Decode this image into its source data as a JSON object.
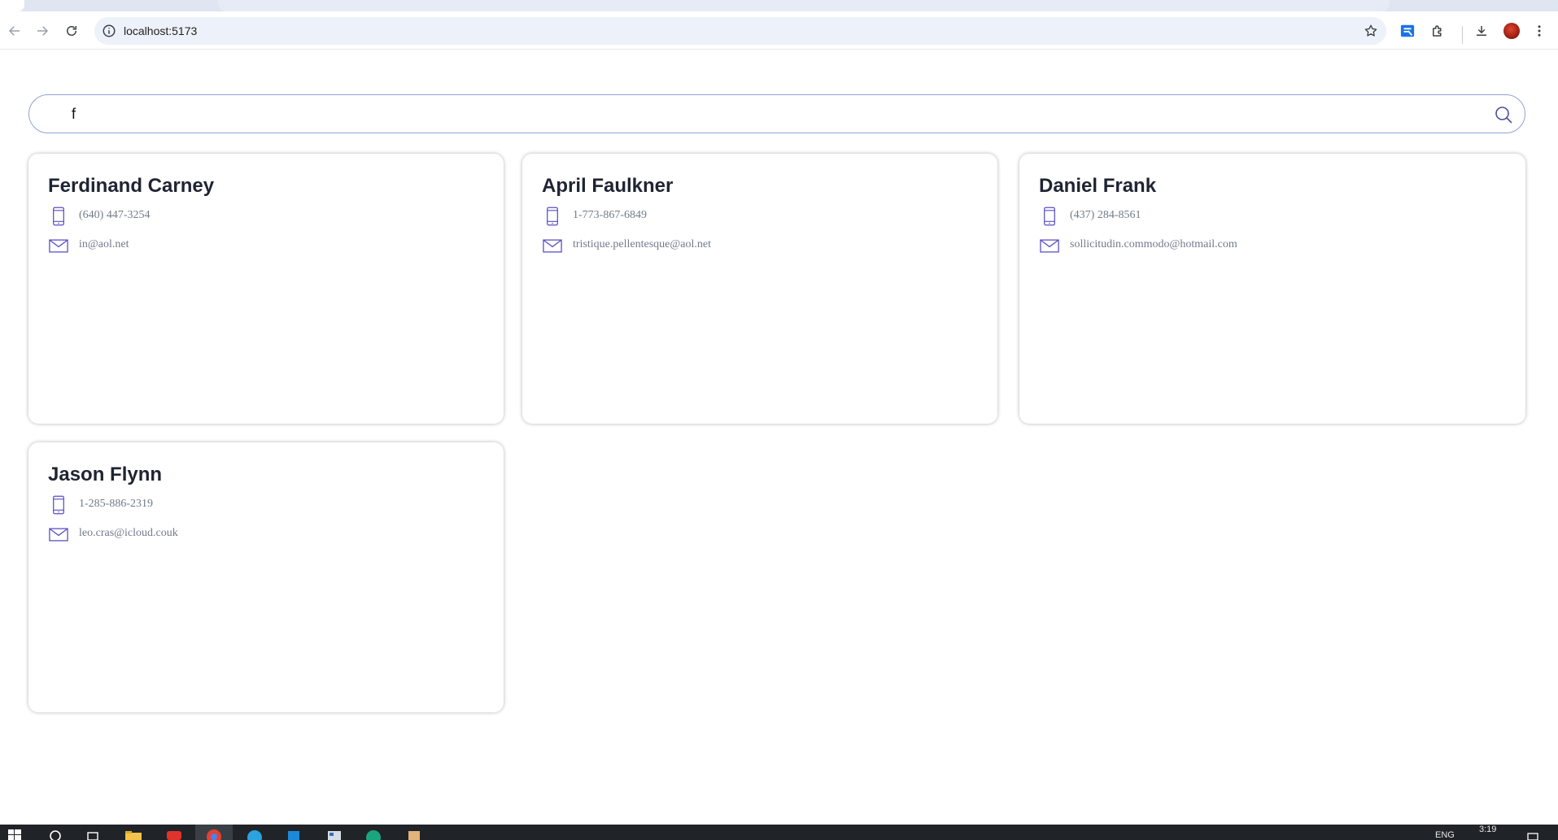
{
  "browser": {
    "url": "localhost:5173"
  },
  "search": {
    "value": "f",
    "placeholder": ""
  },
  "contacts": [
    {
      "name": "Ferdinand Carney",
      "phone": "(640) 447-3254",
      "email": "in@aol.net"
    },
    {
      "name": "April Faulkner",
      "phone": "1-773-867-6849",
      "email": "tristique.pellentesque@aol.net"
    },
    {
      "name": "Daniel Frank",
      "phone": "(437) 284-8561",
      "email": "sollicitudin.commodo@hotmail.com"
    },
    {
      "name": "Jason Flynn",
      "phone": "1-285-886-2319",
      "email": "leo.cras@icloud.couk"
    }
  ],
  "icons": {
    "phone": "smartphone-icon",
    "email": "envelope-icon",
    "search": "search-icon"
  },
  "colors": {
    "accent": "#5b4fc4",
    "search_border": "#93a0d6",
    "name_text": "#1f2433",
    "detail_text": "#727a8a"
  },
  "taskbar": {
    "time": "3:19",
    "language": "ENG"
  }
}
